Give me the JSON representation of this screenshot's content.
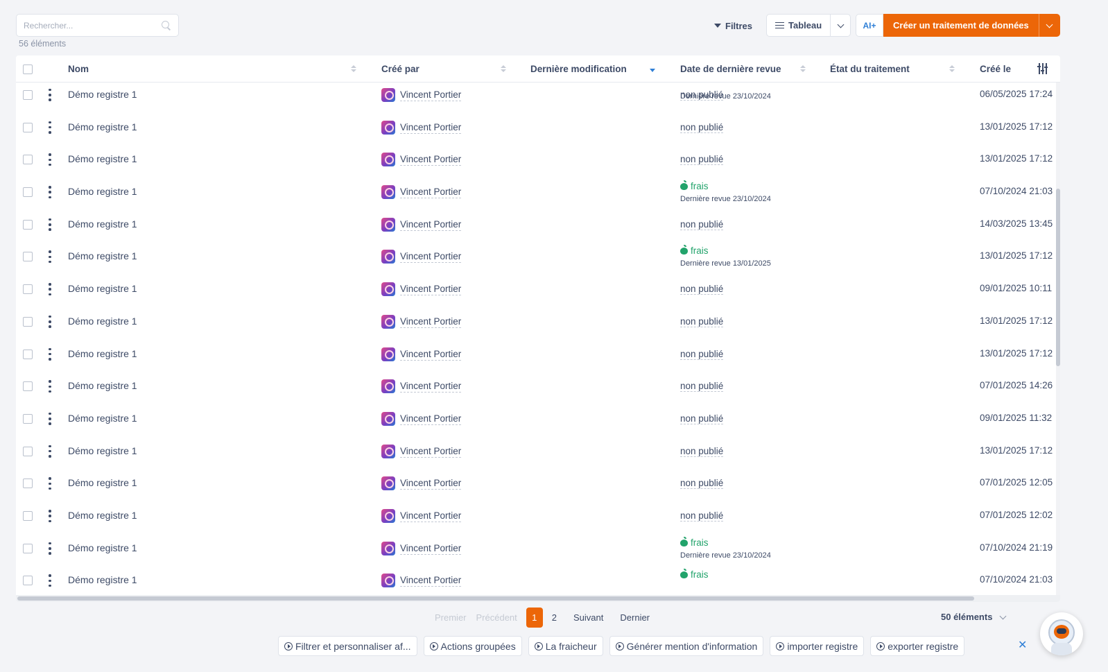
{
  "toolbar": {
    "search_placeholder": "Rechercher...",
    "count": "56 éléments",
    "filters_label": "Filtres",
    "view_label": "Tableau",
    "ai_label": "AI+",
    "create_label": "Créer un traitement de données"
  },
  "table": {
    "columns": {
      "name": "Nom",
      "created_by": "Créé par",
      "last_modified": "Dernière modification",
      "last_review": "Date de dernière revue",
      "state": "État du traitement",
      "created_on": "Créé le"
    },
    "partial_top": {
      "review": "Dernière revue 23/10/2024"
    },
    "rows": [
      {
        "name": "Démo registre 1",
        "user": "Vincent Portier",
        "status": "non publié",
        "review": "",
        "date": "06/05/2025 17:24"
      },
      {
        "name": "Démo registre 1",
        "user": "Vincent Portier",
        "status": "non publié",
        "review": "",
        "date": "13/01/2025 17:12"
      },
      {
        "name": "Démo registre 1",
        "user": "Vincent Portier",
        "status": "non publié",
        "review": "",
        "date": "13/01/2025 17:12"
      },
      {
        "name": "Démo registre 1",
        "user": "Vincent Portier",
        "status": "frais",
        "review": "Dernière revue 23/10/2024",
        "date": "07/10/2024 21:03"
      },
      {
        "name": "Démo registre 1",
        "user": "Vincent Portier",
        "status": "non publié",
        "review": "",
        "date": "14/03/2025 13:45"
      },
      {
        "name": "Démo registre 1",
        "user": "Vincent Portier",
        "status": "frais",
        "review": "Dernière revue 13/01/2025",
        "date": "13/01/2025 17:12"
      },
      {
        "name": "Démo registre 1",
        "user": "Vincent Portier",
        "status": "non publié",
        "review": "",
        "date": "09/01/2025 10:11"
      },
      {
        "name": "Démo registre 1",
        "user": "Vincent Portier",
        "status": "non publié",
        "review": "",
        "date": "13/01/2025 17:12"
      },
      {
        "name": "Démo registre 1",
        "user": "Vincent Portier",
        "status": "non publié",
        "review": "",
        "date": "13/01/2025 17:12"
      },
      {
        "name": "Démo registre 1",
        "user": "Vincent Portier",
        "status": "non publié",
        "review": "",
        "date": "07/01/2025 14:26"
      },
      {
        "name": "Démo registre 1",
        "user": "Vincent Portier",
        "status": "non publié",
        "review": "",
        "date": "09/01/2025 11:32"
      },
      {
        "name": "Démo registre 1",
        "user": "Vincent Portier",
        "status": "non publié",
        "review": "",
        "date": "13/01/2025 17:12"
      },
      {
        "name": "Démo registre 1",
        "user": "Vincent Portier",
        "status": "non publié",
        "review": "",
        "date": "07/01/2025 12:05"
      },
      {
        "name": "Démo registre 1",
        "user": "Vincent Portier",
        "status": "non publié",
        "review": "",
        "date": "07/01/2025 12:02"
      },
      {
        "name": "Démo registre 1",
        "user": "Vincent Portier",
        "status": "frais",
        "review": "Dernière revue 23/10/2024",
        "date": "07/10/2024 21:19"
      },
      {
        "name": "Démo registre 1",
        "user": "Vincent Portier",
        "status": "frais",
        "review": "",
        "date": "07/10/2024 21:03"
      }
    ]
  },
  "pagination": {
    "first": "Premier",
    "previous": "Précédent",
    "pages": [
      "1",
      "2"
    ],
    "next": "Suivant",
    "last": "Dernier",
    "page_size": "50 éléments"
  },
  "tour": {
    "items": [
      "Filtrer et personnaliser af...",
      "Actions groupées",
      "La fraicheur",
      "Générer mention d'information",
      "importer registre",
      "exporter registre"
    ],
    "close": "✕"
  },
  "colors": {
    "accent": "#ec6608",
    "fresh": "#22a36b",
    "link": "#2f7fd6",
    "text": "#3d4a66"
  }
}
